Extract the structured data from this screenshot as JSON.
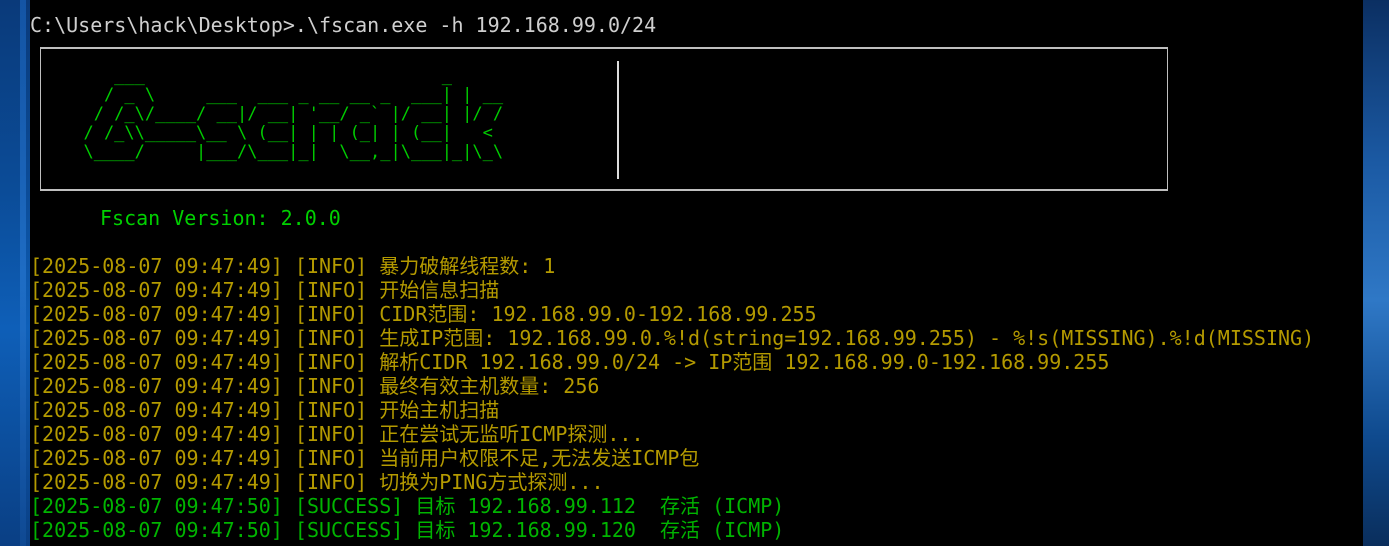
{
  "window": {
    "prompt": "C:\\Users\\hack\\Desktop>",
    "command": ".\\fscan.exe -h 192.168.99.0/24"
  },
  "banner": {
    "ascii_art": "     ___                             _\n    / _ \\     ___  ___ _ __ __ _  ___| | __\n   / /_\\/____/ __|/ __| '__/ _` |/ __| |/ /\n  / /_\\\\_____\\__ \\ (__| | | (_| | (__|   <\n  \\____/     |___/\\___|_|  \\__,_|\\___|_|\\_\\",
    "version": "Fscan Version: 2.0.0"
  },
  "log_lines": [
    {
      "timestamp": "[2025-08-07 09:47:49]",
      "level": "[INFO]",
      "message": "暴力破解线程数: 1"
    },
    {
      "timestamp": "[2025-08-07 09:47:49]",
      "level": "[INFO]",
      "message": "开始信息扫描"
    },
    {
      "timestamp": "[2025-08-07 09:47:49]",
      "level": "[INFO]",
      "message": "CIDR范围: 192.168.99.0-192.168.99.255"
    },
    {
      "timestamp": "[2025-08-07 09:47:49]",
      "level": "[INFO]",
      "message": "生成IP范围: 192.168.99.0.%!d(string=192.168.99.255) - %!s(MISSING).%!d(MISSING)"
    },
    {
      "timestamp": "[2025-08-07 09:47:49]",
      "level": "[INFO]",
      "message": "解析CIDR 192.168.99.0/24 -> IP范围 192.168.99.0-192.168.99.255"
    },
    {
      "timestamp": "[2025-08-07 09:47:49]",
      "level": "[INFO]",
      "message": "最终有效主机数量: 256"
    },
    {
      "timestamp": "[2025-08-07 09:47:49]",
      "level": "[INFO]",
      "message": "开始主机扫描"
    },
    {
      "timestamp": "[2025-08-07 09:47:49]",
      "level": "[INFO]",
      "message": "正在尝试无监听ICMP探测..."
    },
    {
      "timestamp": "[2025-08-07 09:47:49]",
      "level": "[INFO]",
      "message": "当前用户权限不足,无法发送ICMP包"
    },
    {
      "timestamp": "[2025-08-07 09:47:49]",
      "level": "[INFO]",
      "message": "切换为PING方式探测..."
    },
    {
      "timestamp": "[2025-08-07 09:47:50]",
      "level": "[SUCCESS]",
      "message": "目标 192.168.99.112  存活 (ICMP)"
    },
    {
      "timestamp": "[2025-08-07 09:47:50]",
      "level": "[SUCCESS]",
      "message": "目标 192.168.99.120  存活 (ICMP)"
    }
  ],
  "colors": {
    "info": "#b49a00",
    "success": "#00b400",
    "banner": "#00cc00",
    "background": "#000000"
  }
}
